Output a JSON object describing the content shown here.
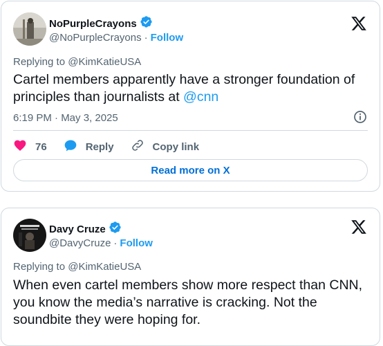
{
  "tweets": [
    {
      "name": "NoPurpleCrayons",
      "handle": "@NoPurpleCrayons",
      "separator": "·",
      "follow": "Follow",
      "replying_to": "Replying to @KimKatieUSA",
      "text_main": "Cartel members apparently have a stronger foundation of principles than journalists at ",
      "text_mention": "@cnn",
      "timestamp": "6:19 PM · May 3, 2025",
      "likes": "76",
      "reply_label": "Reply",
      "copy_label": "Copy link",
      "read_more": "Read more on X"
    },
    {
      "name": "Davy Cruze",
      "handle": "@DavyCruze",
      "separator": "·",
      "follow": "Follow",
      "replying_to": "Replying to @KimKatieUSA",
      "text_main": "When even cartel members show more respect than CNN, you know the media’s narrative is cracking. Not the soundbite they were hoping for."
    }
  ],
  "colors": {
    "accent": "#1d9bf0",
    "like": "#f91880",
    "border": "#cfd9de",
    "muted": "#536471"
  },
  "icons": [
    "verified-badge-icon",
    "x-logo-icon",
    "heart-icon",
    "reply-bubble-icon",
    "link-icon",
    "info-icon"
  ]
}
